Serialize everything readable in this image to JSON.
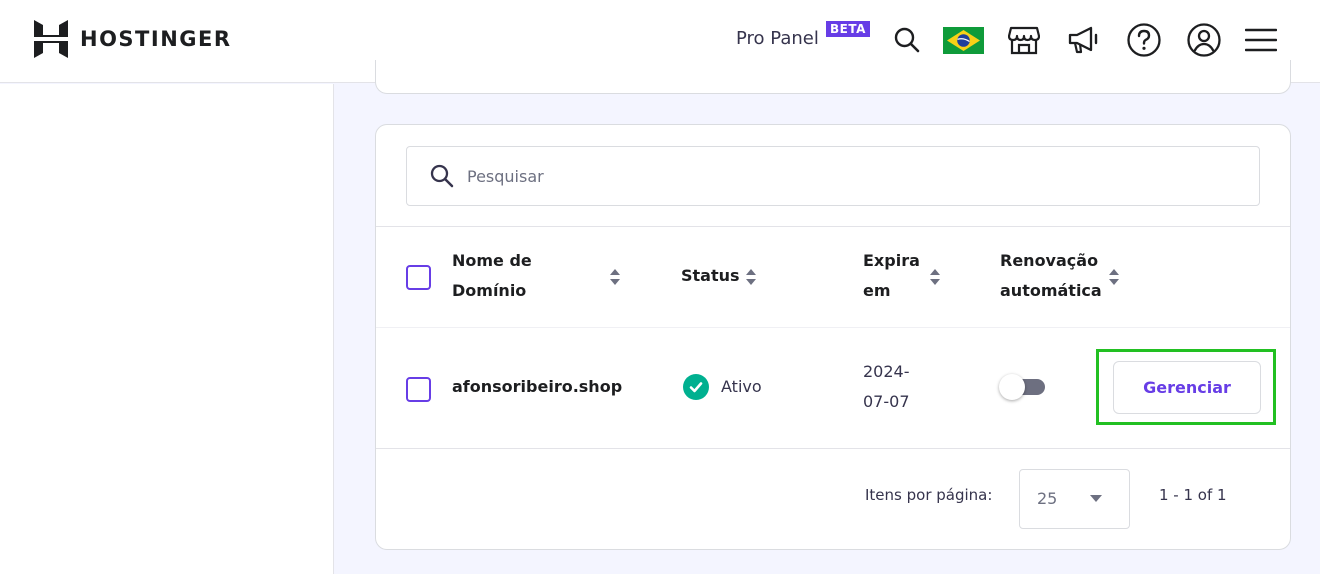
{
  "header": {
    "brand": "HOSTINGER",
    "pro_panel": "Pro Panel",
    "beta": "BETA",
    "icons": [
      "search-icon",
      "brazil-flag-icon",
      "store-icon",
      "megaphone-icon",
      "help-icon",
      "account-icon",
      "menu-icon"
    ]
  },
  "search": {
    "placeholder": "Pesquisar"
  },
  "table": {
    "columns": {
      "domain_line1": "Nome de",
      "domain_line2": "Domínio",
      "status": "Status",
      "expires_line1": "Expira",
      "expires_line2": "em",
      "renewal_line1": "Renovação",
      "renewal_line2": "automática"
    },
    "rows": [
      {
        "domain": "afonsoribeiro.shop",
        "status": "Ativo",
        "expires_line1": "2024-",
        "expires_line2": "07-07",
        "auto_renew": false,
        "action": "Gerenciar"
      }
    ]
  },
  "pagination": {
    "per_page_label": "Itens por página:",
    "per_page_value": "25",
    "range": "1 - 1 of 1"
  },
  "colors": {
    "accent": "#673de6",
    "success": "#00b090",
    "highlight": "#22c022",
    "background": "#f4f5ff"
  }
}
